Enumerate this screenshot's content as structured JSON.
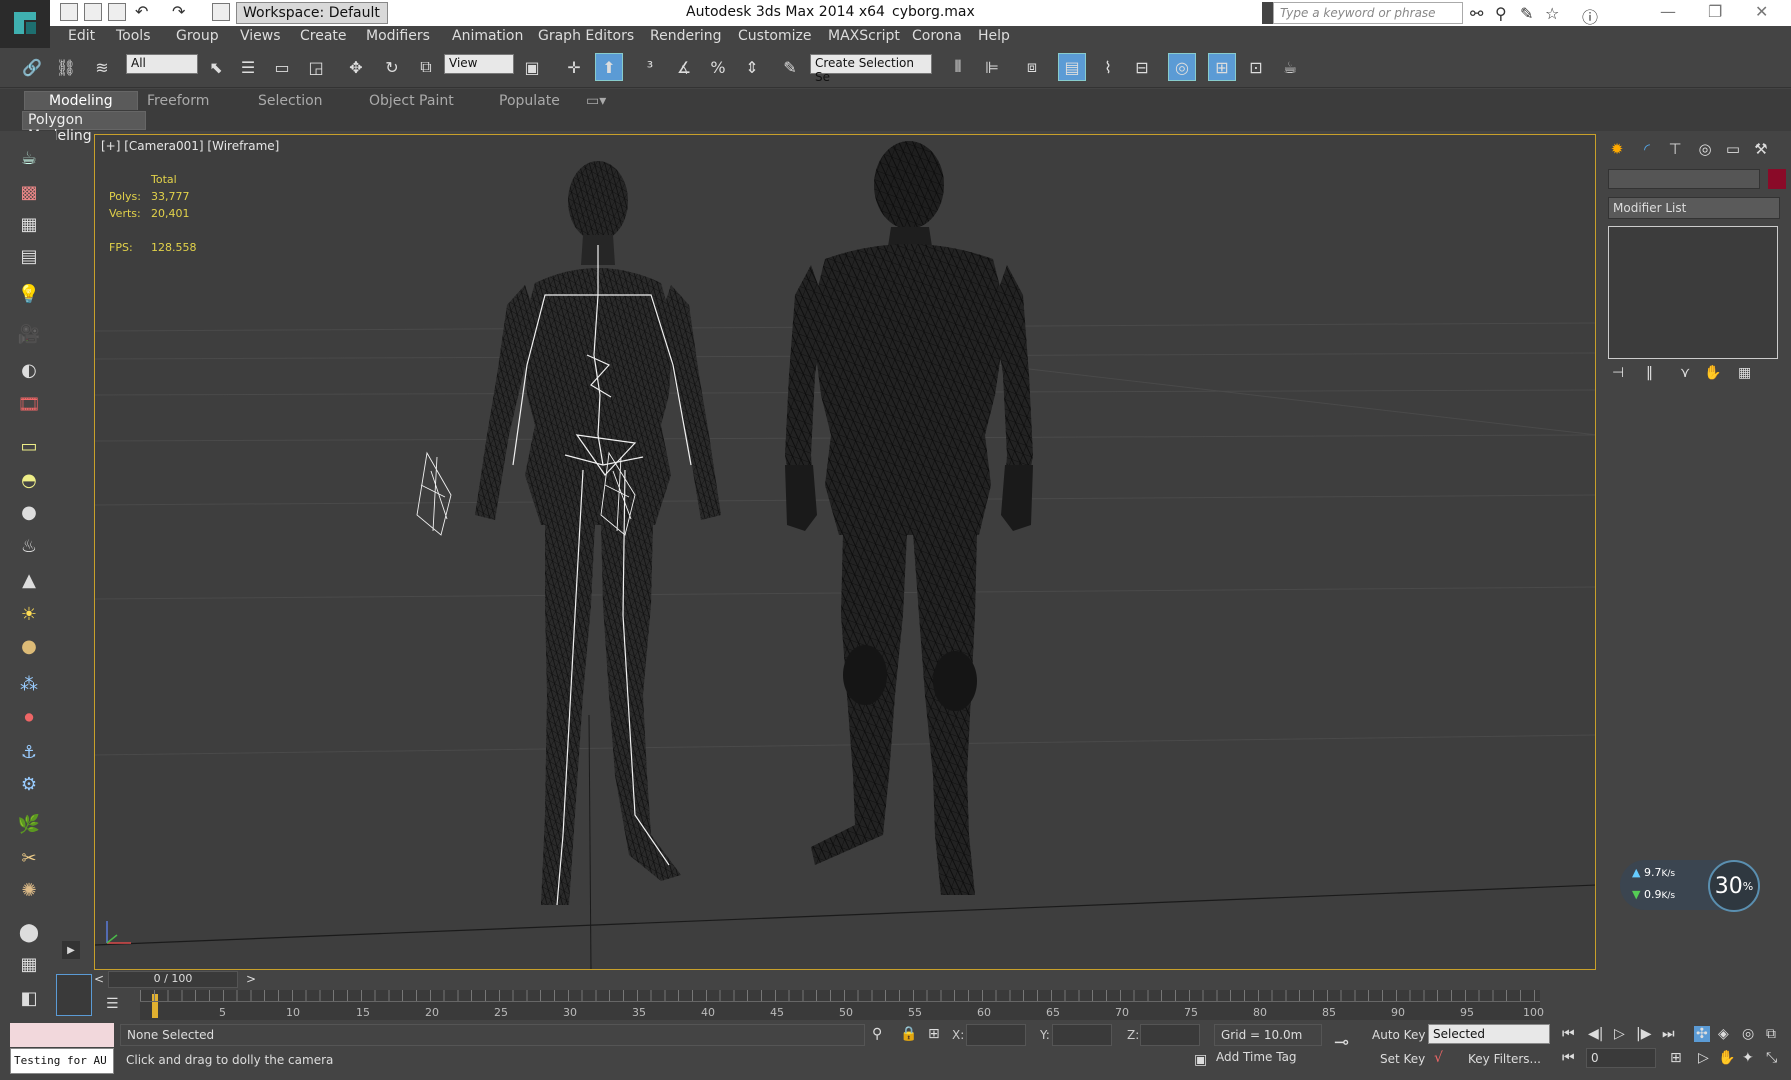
{
  "title_bar": {
    "workspace": "Workspace: Default",
    "app_title": "Autodesk 3ds Max  2014 x64",
    "file_name": "cyborg.max",
    "search_placeholder": "Type a keyword or phrase"
  },
  "menu": [
    "Edit",
    "Tools",
    "Group",
    "Views",
    "Create",
    "Modifiers",
    "Animation",
    "Graph Editors",
    "Rendering",
    "Customize",
    "MAXScript",
    "Corona",
    "Help"
  ],
  "toolbar": {
    "selection_filter": "All",
    "ref_coord": "View",
    "selection_set_placeholder": "Create Selection Se"
  },
  "ribbon": {
    "tabs": [
      "Modeling",
      "Freeform",
      "Selection",
      "Object Paint",
      "Populate"
    ],
    "active_tab": "Modeling",
    "panel_label": "Polygon Modeling"
  },
  "viewport": {
    "label": "[+] [Camera001] [Wireframe]",
    "stats": {
      "total_label": "Total",
      "polys_label": "Polys:",
      "polys_value": "33,777",
      "verts_label": "Verts:",
      "verts_value": "20,401",
      "fps_label": "FPS:",
      "fps_value": "128.558"
    }
  },
  "command_panel": {
    "modifier_list": "Modifier List",
    "object_color": "#8a0a28"
  },
  "net_widget": {
    "upload": "9.7",
    "download": "0.9",
    "unit": "K/s",
    "percent": "30",
    "percent_sign": "%"
  },
  "timeline": {
    "frame_display": "0 / 100",
    "ticks": [
      "5",
      "10",
      "15",
      "20",
      "25",
      "30",
      "35",
      "40",
      "45",
      "50",
      "55",
      "60",
      "65",
      "70",
      "75",
      "80",
      "85",
      "90",
      "95",
      "100"
    ]
  },
  "status": {
    "maxscript_text": "Testing for AU",
    "selection": "None Selected",
    "prompt": "Click and drag to dolly the camera",
    "x_label": "X:",
    "y_label": "Y:",
    "z_label": "Z:",
    "grid": "Grid = 10.0m",
    "add_time_tag": "Add Time Tag",
    "auto_key": "Auto Key",
    "set_key": "Set Key",
    "selected": "Selected",
    "key_filters": "Key Filters...",
    "current_frame": "0"
  }
}
